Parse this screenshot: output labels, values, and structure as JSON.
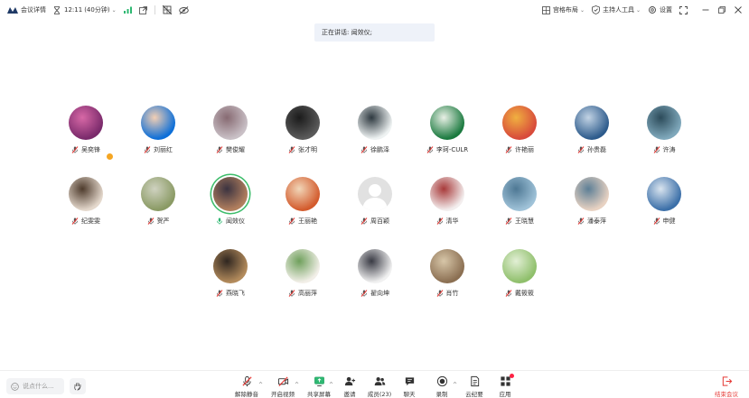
{
  "topbar": {
    "meeting_info": "会议详情",
    "time": "12:11",
    "duration": "(40分钟)",
    "layout": "宫格布局",
    "host_tools": "主持人工具",
    "settings": "设置"
  },
  "speaking": {
    "text": "正在讲话: 闻效仪;"
  },
  "participants": [
    {
      "name": "吴奕锋",
      "color1": "#7a2a6b",
      "color2": "#d768a6",
      "badge": true
    },
    {
      "name": "刘丽红",
      "color1": "#0d6fd8",
      "color2": "#f3cfb4"
    },
    {
      "name": "樊俊耀",
      "color1": "#c9c0c6",
      "color2": "#876a72"
    },
    {
      "name": "张才明",
      "color1": "#5a5a5a",
      "color2": "#1b1b1b"
    },
    {
      "name": "徐鹏泽",
      "color1": "#eef2f2",
      "color2": "#2e3940"
    },
    {
      "name": "李珂-CULR",
      "color1": "#1b7a3f",
      "color2": "#e9f0e6"
    },
    {
      "name": "许艳丽",
      "color1": "#d84a3b",
      "color2": "#f0b040"
    },
    {
      "name": "孙贵磊",
      "color1": "#2d5b8c",
      "color2": "#c2d3e4"
    },
    {
      "name": "许涛",
      "color1": "#7fa8bb",
      "color2": "#2c4b5a"
    },
    {
      "name": "纪雯雯",
      "color1": "#e4d8cc",
      "color2": "#4e3b2c"
    },
    {
      "name": "贺严",
      "color1": "#8a9a64",
      "color2": "#cfd2c0"
    },
    {
      "name": "闻效仪",
      "color1": "#b27f5e",
      "color2": "#3b3340",
      "active": true
    },
    {
      "name": "王丽艳",
      "color1": "#d35b2d",
      "color2": "#f1d6b8"
    },
    {
      "name": "周百颖",
      "color1": "#e1e1e1",
      "color2": "#c2c2c2",
      "placeholder": true
    },
    {
      "name": "清华",
      "color1": "#f3eeee",
      "color2": "#a83a3a"
    },
    {
      "name": "王晓慧",
      "color1": "#9fc2d8",
      "color2": "#4e7894"
    },
    {
      "name": "潘泰萍",
      "color1": "#e8d2c2",
      "color2": "#5d7f96"
    },
    {
      "name": "申健",
      "color1": "#3b6fa8",
      "color2": "#d9e4ef"
    },
    {
      "name": "燕晓飞",
      "color1": "#b38b5c",
      "color2": "#2f2620"
    },
    {
      "name": "高丽萍",
      "color1": "#f2efe8",
      "color2": "#6fa05c"
    },
    {
      "name": "翟向坤",
      "color1": "#f1f1f1",
      "color2": "#393a44"
    },
    {
      "name": "肖竹",
      "color1": "#8b6f52",
      "color2": "#d7c6a8"
    },
    {
      "name": "戴筱筱",
      "color1": "#8fbf6b",
      "color2": "#e2efd5"
    }
  ],
  "bottombar": {
    "chat_placeholder": "说点什么...",
    "unmute": "解除静音",
    "start_video": "开启视频",
    "share_screen": "共享屏幕",
    "invite": "邀请",
    "members": "成员(23)",
    "chat": "聊天",
    "record": "录制",
    "minutes": "云纪要",
    "apps": "应用",
    "end_meeting": "结束会议"
  },
  "colors": {
    "accent": "#1a73e8",
    "mute_red": "#e53935",
    "active_green": "#3ebd6b",
    "speaking_bg": "#eef2f9"
  }
}
